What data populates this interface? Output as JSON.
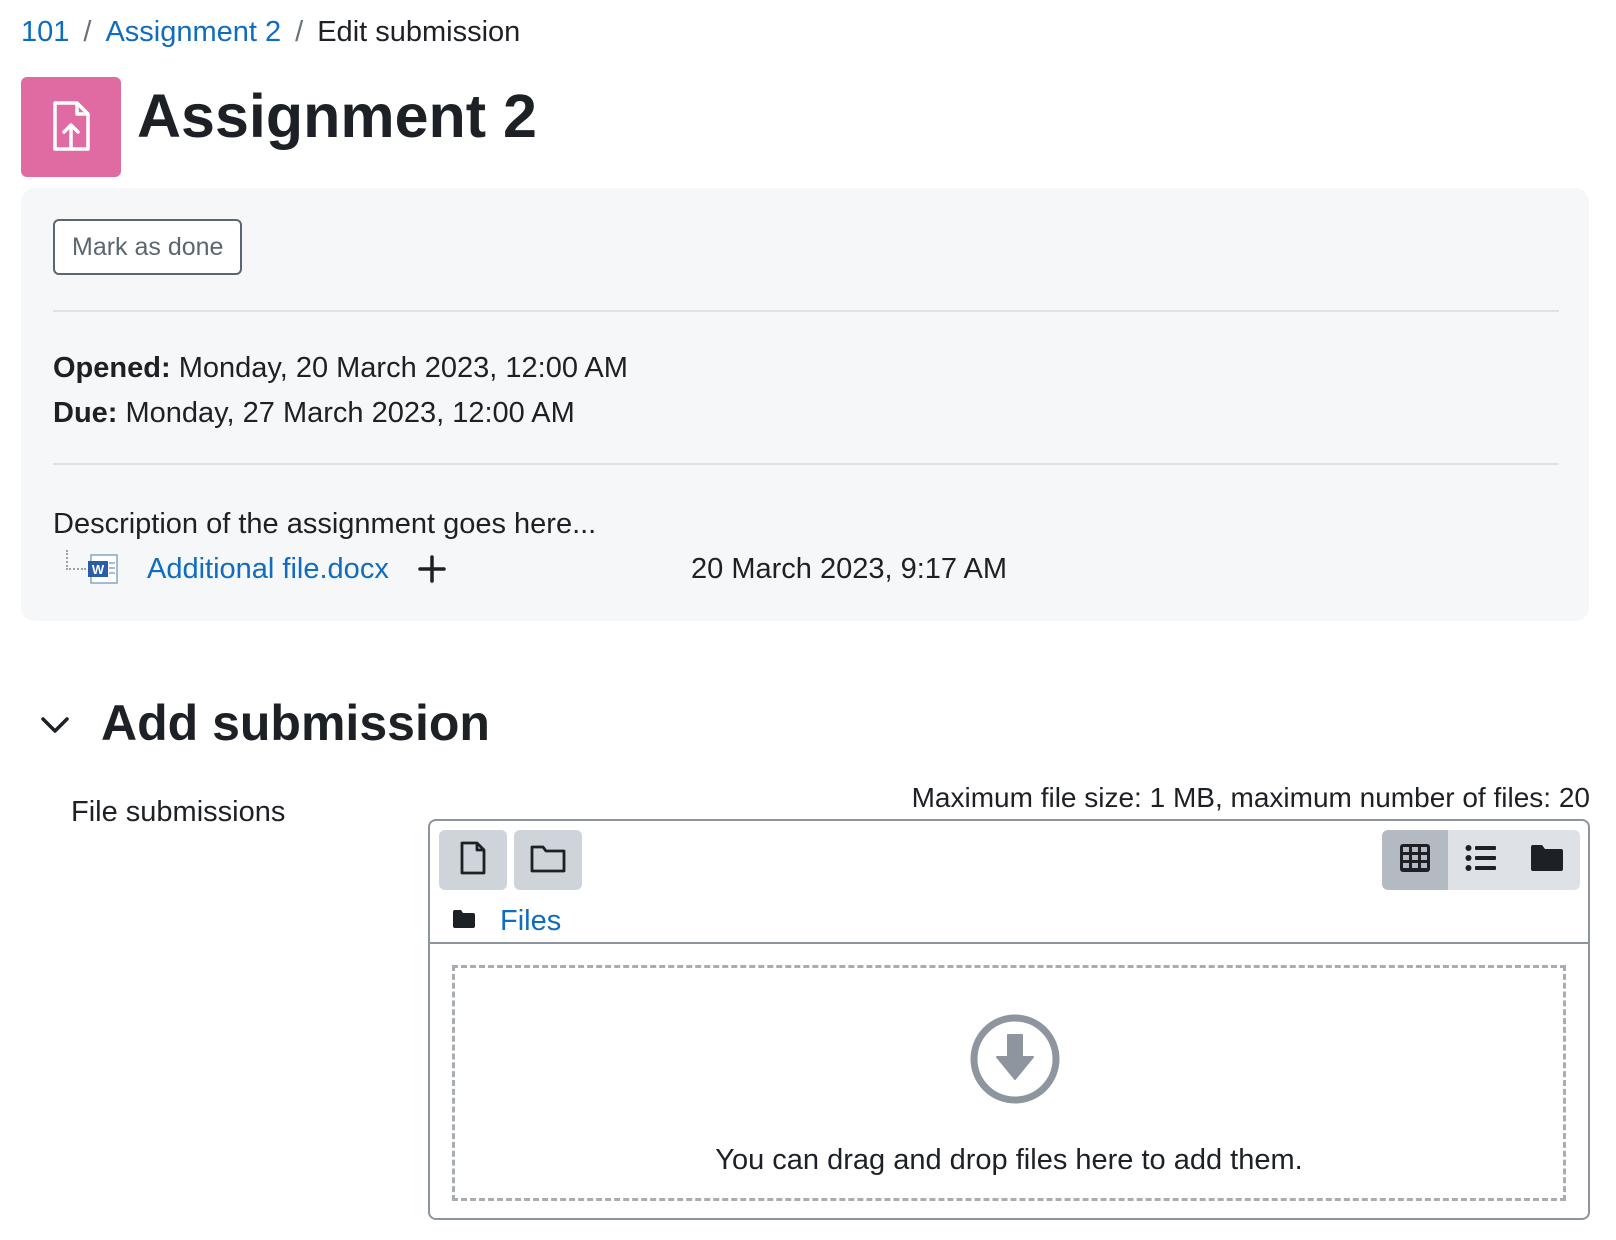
{
  "breadcrumb": {
    "items": [
      {
        "label": "101"
      },
      {
        "label": "Assignment 2"
      }
    ],
    "current": "Edit submission",
    "separator": "/"
  },
  "header": {
    "icon": "assignment-upload-icon",
    "icon_color": "#e06ba3",
    "title": "Assignment 2"
  },
  "activity": {
    "mark_done_label": "Mark as done",
    "opened_label": "Opened:",
    "opened_value": "Monday, 20 March 2023, 12:00 AM",
    "due_label": "Due:",
    "due_value": "Monday, 27 March 2023, 12:00 AM",
    "description": "Description of the assignment goes here...",
    "attachment": {
      "name": "Additional file.docx",
      "icon": "word-document-icon",
      "date": "20 March 2023, 9:17 AM"
    }
  },
  "submission": {
    "section_title": "Add submission",
    "field_label": "File submissions",
    "limits_text": "Maximum file size: 1 MB, maximum number of files: 20",
    "filemanager": {
      "path_label": "Files",
      "dropzone_text": "You can drag and drop files here to add them.",
      "active_view": "icons"
    }
  },
  "colors": {
    "link": "#0f6cbf",
    "text": "#1d2125",
    "panel_bg": "#f6f7f8"
  }
}
